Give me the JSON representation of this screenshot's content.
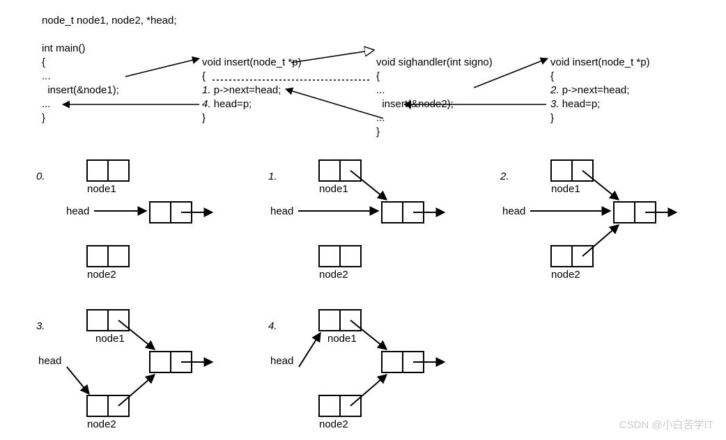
{
  "decl": "node_t node1, node2, *head;",
  "main": {
    "sig": "int main()",
    "open": "{",
    "dots1": "...",
    "call": "  insert(&node1);",
    "dots2": "...",
    "close": "}"
  },
  "insert1": {
    "sig": "void insert(node_t *p)",
    "open": "{",
    "l1": "1.",
    "l1_code": "p->next=head;",
    "l4": "4.",
    "l4_code": "head=p;",
    "close": "}"
  },
  "sighandler": {
    "sig": "void sighandler(int signo)",
    "open": "{",
    "dots": "...",
    "call": "  insert(&node2);",
    "dots2": "...",
    "close": "}"
  },
  "insert2": {
    "sig": "void insert(node_t *p)",
    "open": "{",
    "l2": "2.",
    "l2_code": "p->next=head;",
    "l3": "3.",
    "l3_code": "head=p;",
    "close": "}"
  },
  "steps": [
    "0.",
    "1.",
    "2.",
    "3.",
    "4."
  ],
  "labels": {
    "node1": "node1",
    "node2": "node2",
    "head": "head"
  },
  "watermark": "CSDN @小白苦学IT"
}
